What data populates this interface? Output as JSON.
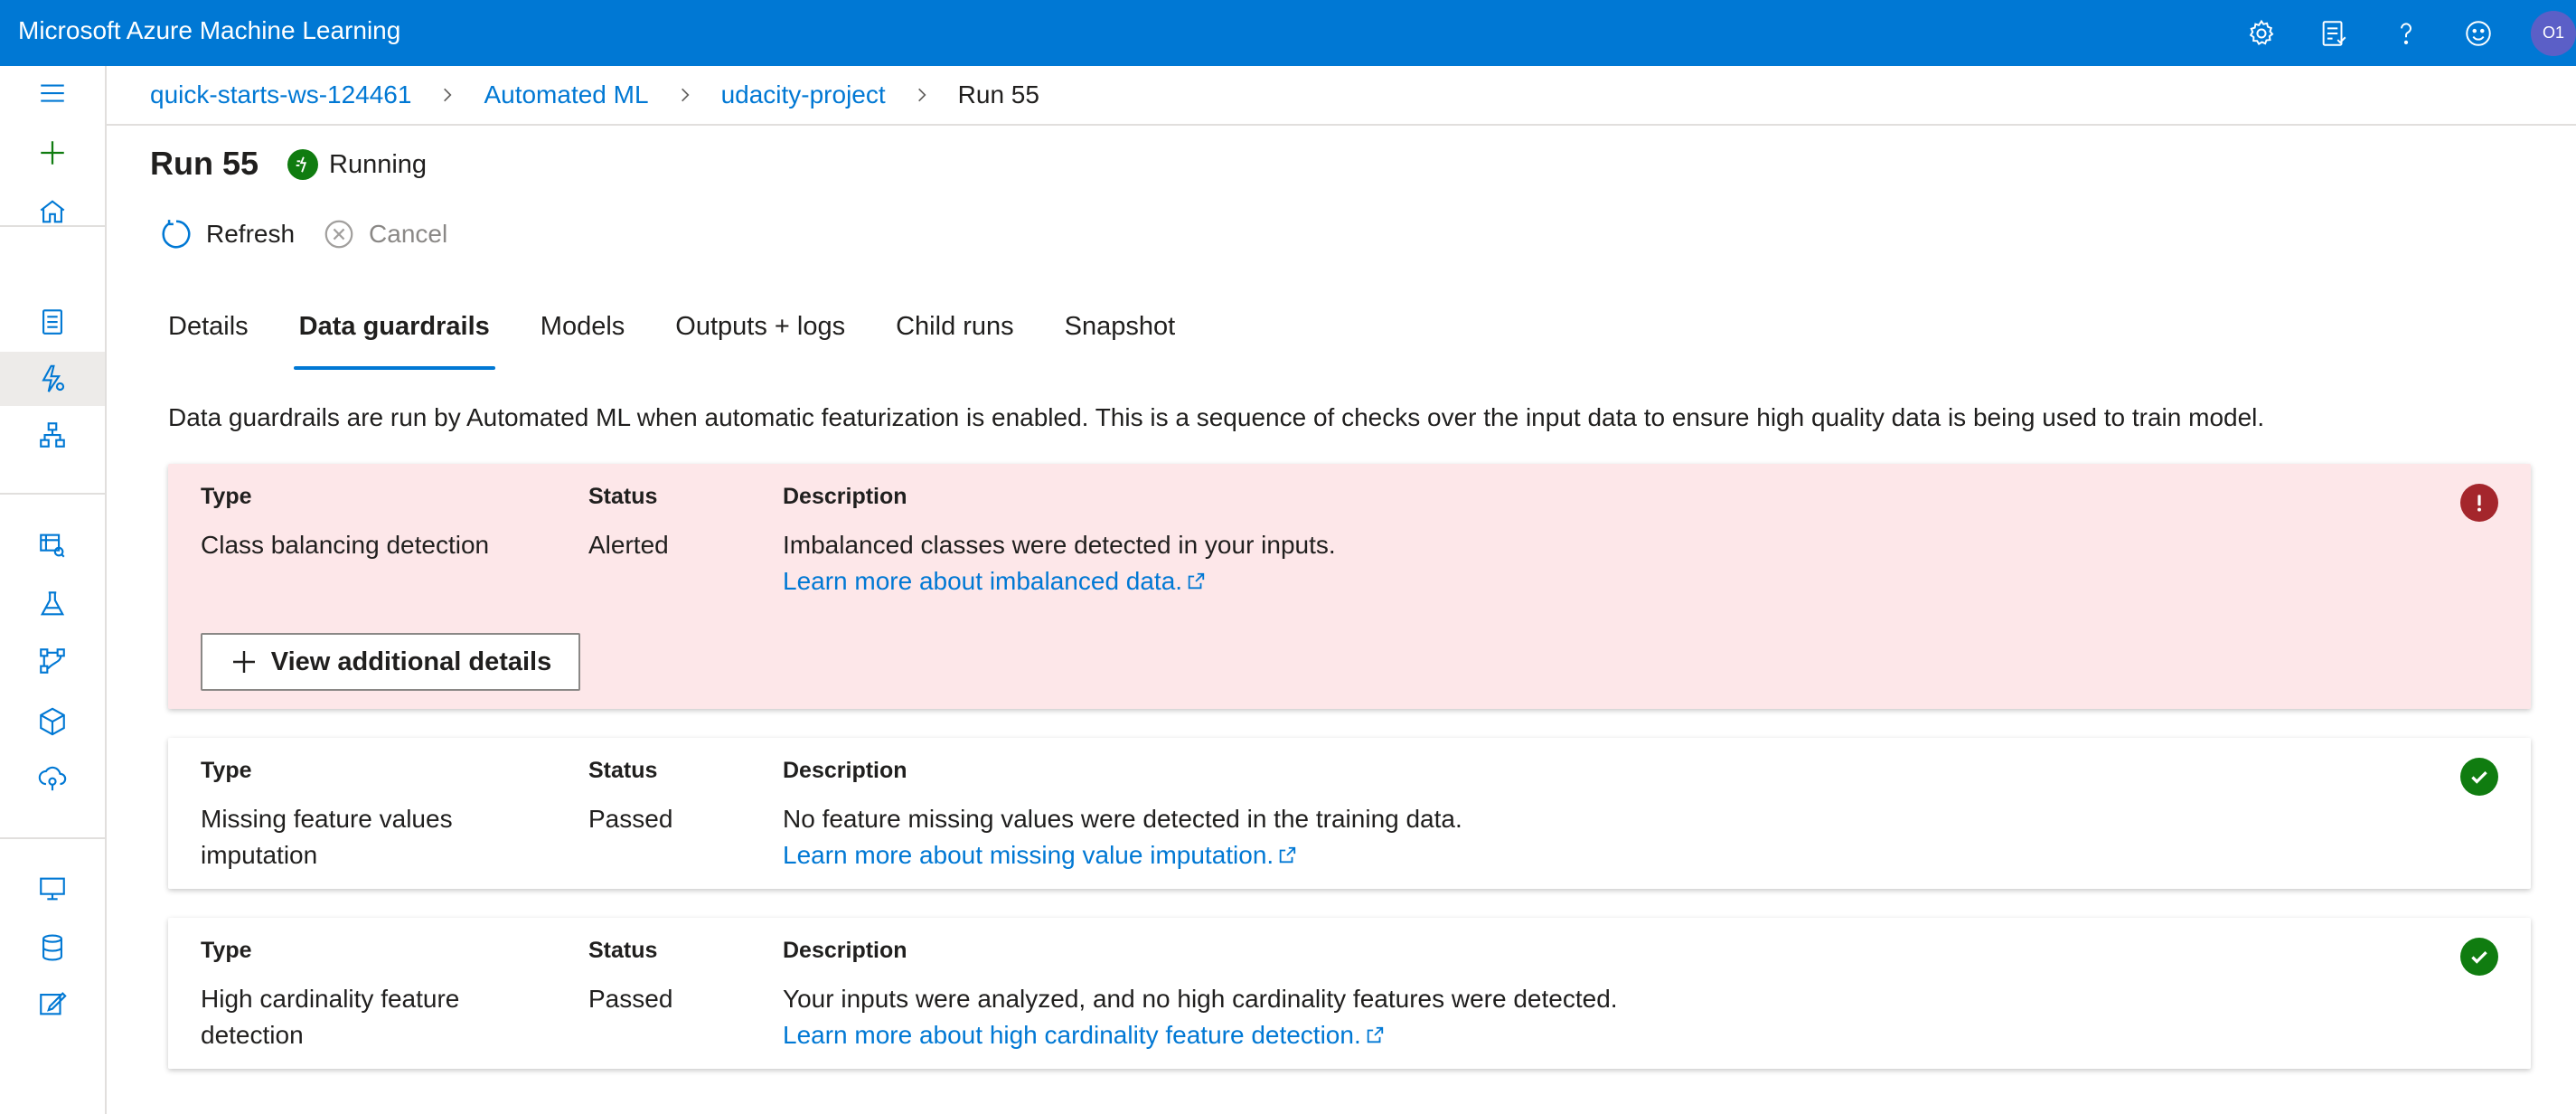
{
  "app": {
    "title": "Microsoft Azure Machine Learning",
    "avatar_initials": "O1"
  },
  "topbar_icons": [
    "gear-icon",
    "feedback-list-icon",
    "help-icon",
    "smiley-icon"
  ],
  "breadcrumb": {
    "items": [
      "quick-starts-ws-124461",
      "Automated ML",
      "udacity-project"
    ],
    "current": "Run 55"
  },
  "run": {
    "title": "Run 55",
    "status": "Running"
  },
  "commands": {
    "refresh": "Refresh",
    "cancel": "Cancel"
  },
  "tabs": [
    "Details",
    "Data guardrails",
    "Models",
    "Outputs + logs",
    "Child runs",
    "Snapshot"
  ],
  "active_tab": "Data guardrails",
  "intro": "Data guardrails are run by Automated ML when automatic featurization is enabled. This is a sequence of checks over the input data to ensure high quality data is being used to train model.",
  "columns": {
    "type": "Type",
    "status": "Status",
    "description": "Description"
  },
  "guardrails": [
    {
      "type": "Class balancing detection",
      "status": "Alerted",
      "description": "Imbalanced classes were detected in your inputs.",
      "link": "Learn more about imbalanced data.",
      "button": "View additional details",
      "icon": "alert-icon",
      "color": "#a4262c"
    },
    {
      "type_line1": "Missing feature values",
      "type_line2": "imputation",
      "status": "Passed",
      "description": "No feature missing values were detected in the training data.",
      "link": "Learn more about missing value imputation.",
      "icon": "check-icon",
      "color": "#107c10"
    },
    {
      "type_line1": "High cardinality feature",
      "type_line2": "detection",
      "status": "Passed",
      "description": "Your inputs were analyzed, and no high cardinality features were detected.",
      "link": "Learn more about high cardinality feature detection.",
      "icon": "check-icon",
      "color": "#107c10"
    }
  ],
  "colors": {
    "brand": "#0078d4",
    "alert_bg": "#fde7e9",
    "success": "#107c10",
    "error": "#a4262c"
  }
}
